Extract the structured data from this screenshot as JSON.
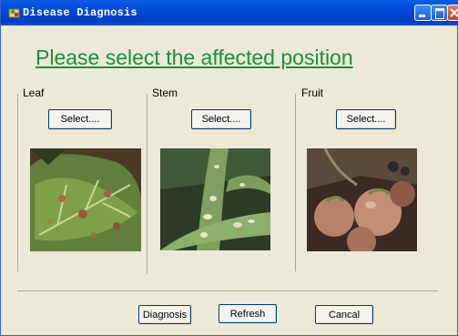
{
  "window": {
    "title": "Disease Diagnosis"
  },
  "heading": "Please select the affected position",
  "columns": [
    {
      "label": "Leaf",
      "button": "Select....",
      "image": "tomato-leaf-disease-photo"
    },
    {
      "label": "Stem",
      "button": "Select....",
      "image": "tomato-stem-disease-photo"
    },
    {
      "label": "Fruit",
      "button": "Select....",
      "image": "tomato-fruit-disease-photo"
    }
  ],
  "footer": {
    "diagnosis": "Diagnosis",
    "refresh": "Refresh",
    "cancel": "Cancal"
  },
  "colors": {
    "heading": "#1a8f3c",
    "titlebar": "#0049d6",
    "window_bg": "#ece9d8"
  }
}
